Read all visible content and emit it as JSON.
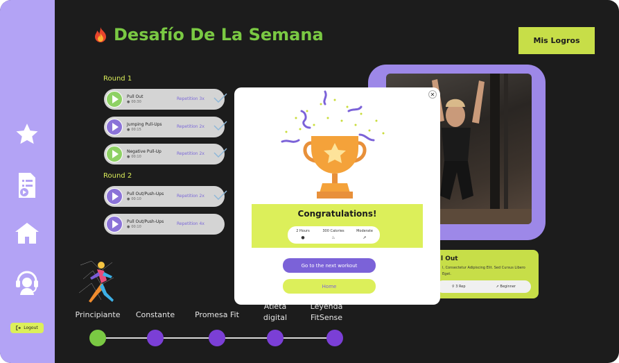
{
  "sidebar": {
    "icons": [
      "star-icon",
      "document-play-icon",
      "home-icon",
      "support-headset-icon"
    ],
    "logout_label": "Logout"
  },
  "header": {
    "title": "Desafío De La Semana",
    "title_icon": "fire-icon",
    "mis_logros_label": "Mis Logros"
  },
  "rounds": [
    {
      "label": "Round 1",
      "exercises": [
        {
          "name": "Pull Out",
          "time": "00:30",
          "repetition": "Repetition 3x"
        },
        {
          "name": "Jumping Pull-Ups",
          "time": "00:15",
          "repetition": "Repetition 2x"
        },
        {
          "name": "Negative Pull-Up",
          "time": "00:10",
          "repetition": "Repetition 2x"
        }
      ]
    },
    {
      "label": "Round 2",
      "exercises": [
        {
          "name": "Pull Out/Push-Ups",
          "time": "00:10",
          "repetition": "Repetition 2x"
        },
        {
          "name": "Pull Out/Push-Ups",
          "time": "00:10",
          "repetition": "Repetition 4x"
        }
      ]
    }
  ],
  "info_card": {
    "title": "l Out",
    "description": "l, Consectetur Adipiscing Elit. Sed Cursus Libero Eget.",
    "reps": "3 Rep",
    "level": "Beginner"
  },
  "levels": [
    {
      "label": "Principiante",
      "color": "#7ac943"
    },
    {
      "label": "Constante",
      "color": "#7b3fd6"
    },
    {
      "label": "Promesa Fit",
      "color": "#7b3fd6"
    },
    {
      "label": "Atleta digital",
      "color": "#7b3fd6"
    },
    {
      "label": "Leyenda FitSense",
      "color": "#7b3fd6"
    }
  ],
  "modal": {
    "close_icon": "close-icon",
    "title": "Congratulations!",
    "stats": [
      "2 Hours",
      "300 Calories",
      "Moderate"
    ],
    "next_button": "Go to the next workout",
    "home_button": "Home"
  },
  "colors": {
    "sidebar": "#b3a3f5",
    "accent_green": "#7ac943",
    "accent_lime": "#dcef5a",
    "accent_purple": "#7b62d8",
    "background": "#1c1c1c"
  }
}
